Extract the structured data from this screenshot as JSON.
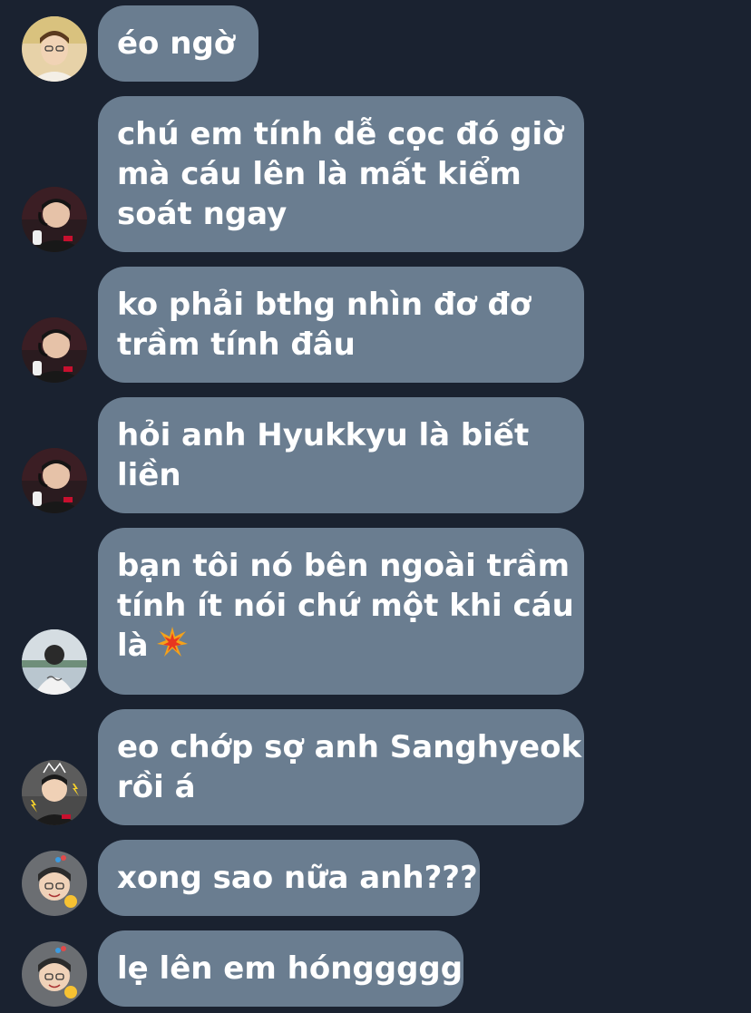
{
  "conversation": {
    "messages": [
      {
        "avatar": "user-avatar-1",
        "lines": [
          "éo ngờ"
        ]
      },
      {
        "avatar": "user-avatar-2",
        "lines": [
          "chú em tính dễ cọc đó giờ",
          "mà cáu lên là mất kiểm",
          "soát ngay"
        ]
      },
      {
        "avatar": "user-avatar-2",
        "lines": [
          "ko phải bthg nhìn đơ đơ",
          "trầm tính đâu"
        ]
      },
      {
        "avatar": "user-avatar-2",
        "lines": [
          "hỏi anh Hyukkyu là biết",
          "liền"
        ]
      },
      {
        "avatar": "user-avatar-3",
        "lines": [
          "bạn tôi nó bên ngoài trầm",
          "tính ít nói chứ một khi cáu",
          "là"
        ],
        "emoji": "collision-emoji"
      },
      {
        "avatar": "user-avatar-4",
        "lines": [
          "eo chớp sợ anh Sanghyeok",
          "rồi á"
        ]
      },
      {
        "avatar": "user-avatar-5",
        "lines": [
          "xong sao nữa anh???"
        ]
      },
      {
        "avatar": "user-avatar-5",
        "lines": [
          "lẹ lên em hónggggg"
        ]
      }
    ]
  },
  "colors": {
    "background": "#1a2230",
    "bubble": "#6a7d90",
    "text": "#ffffff"
  }
}
